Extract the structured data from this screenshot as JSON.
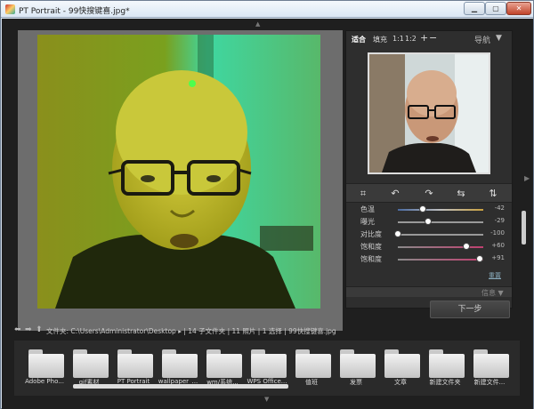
{
  "window": {
    "title": "99快搜键喜.jpg*",
    "app_name": "PT Portrait",
    "min_icon": "minimize-icon",
    "max_icon": "maximize-icon",
    "close_icon": "close-icon"
  },
  "zoom": {
    "fit": "适合",
    "fill": "填充",
    "one_to_one": "1:1",
    "one_to_two": "1:2",
    "plus": "+",
    "minus": "−",
    "navigator": "导航",
    "chevron": "▼"
  },
  "tools": [
    {
      "name": "crop-icon",
      "glyph": "⌗"
    },
    {
      "name": "rotate-left-icon",
      "glyph": "↶"
    },
    {
      "name": "rotate-right-icon",
      "glyph": "↷"
    },
    {
      "name": "flip-horizontal-icon",
      "glyph": "⇆"
    },
    {
      "name": "flip-vertical-icon",
      "glyph": "⇅"
    }
  ],
  "adjustments": [
    {
      "label": "色温",
      "value": "-42",
      "level": 0.29
    },
    {
      "label": "曝光",
      "value": "-29",
      "level": 0.35
    },
    {
      "label": "对比度",
      "value": "-100",
      "level": 0.0
    },
    {
      "label": "饱和度",
      "value": "+60",
      "level": 0.8
    },
    {
      "label": "饱和度",
      "value": "+91",
      "level": 0.955
    }
  ],
  "reset_label": "重置",
  "sub_header": "信息 ▼",
  "next_button": "下一步",
  "path_bar": {
    "back": "⬅",
    "forward": "➡",
    "up": "⬆",
    "text": "文件夹: C:\\Users\\Administrator\\Desktop ▸ | 14 子文件夹 | 11 照片 | 1 选择 | 99快搜键喜.jpg"
  },
  "folders": [
    "Adobe Pho...",
    "gif素材",
    "PT Portrait",
    "wallpaper_...",
    "wm/系统...",
    "WPS Office...",
    "值班",
    "发票",
    "文章",
    "新建文件夹",
    "新建文件..."
  ],
  "colors": {
    "background": "#1f1f1f",
    "panel": "#2e2e2e",
    "accent_slider": "#c04070"
  }
}
